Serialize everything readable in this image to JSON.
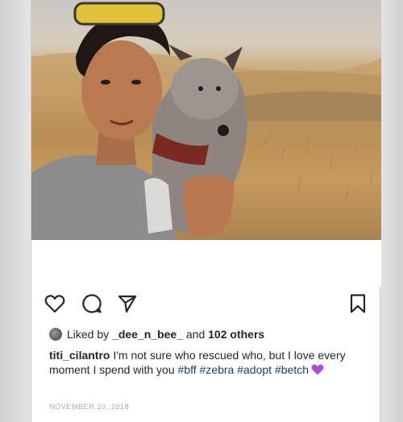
{
  "post": {
    "liked_by_prefix": "Liked by",
    "liked_by_user": "_dee_n_bee_",
    "liked_by_and": "and",
    "liked_by_others": "102 others",
    "caption_user": "titi_cilantro",
    "caption_text": "I'm not sure who rescued who, but I love every moment I spend with you",
    "hashtags": [
      "#bff",
      "#zebra",
      "#adopt",
      "#betch"
    ],
    "date": "NOVEMBER 20, 2018"
  },
  "icons": {
    "like": "heart-icon",
    "comment": "comment-icon",
    "share": "send-icon",
    "save": "bookmark-icon",
    "emoji": "purple-heart-emoji"
  },
  "colors": {
    "text": "#262626",
    "hashtag": "#1f3b6d",
    "emoji": "#a64fd6"
  }
}
